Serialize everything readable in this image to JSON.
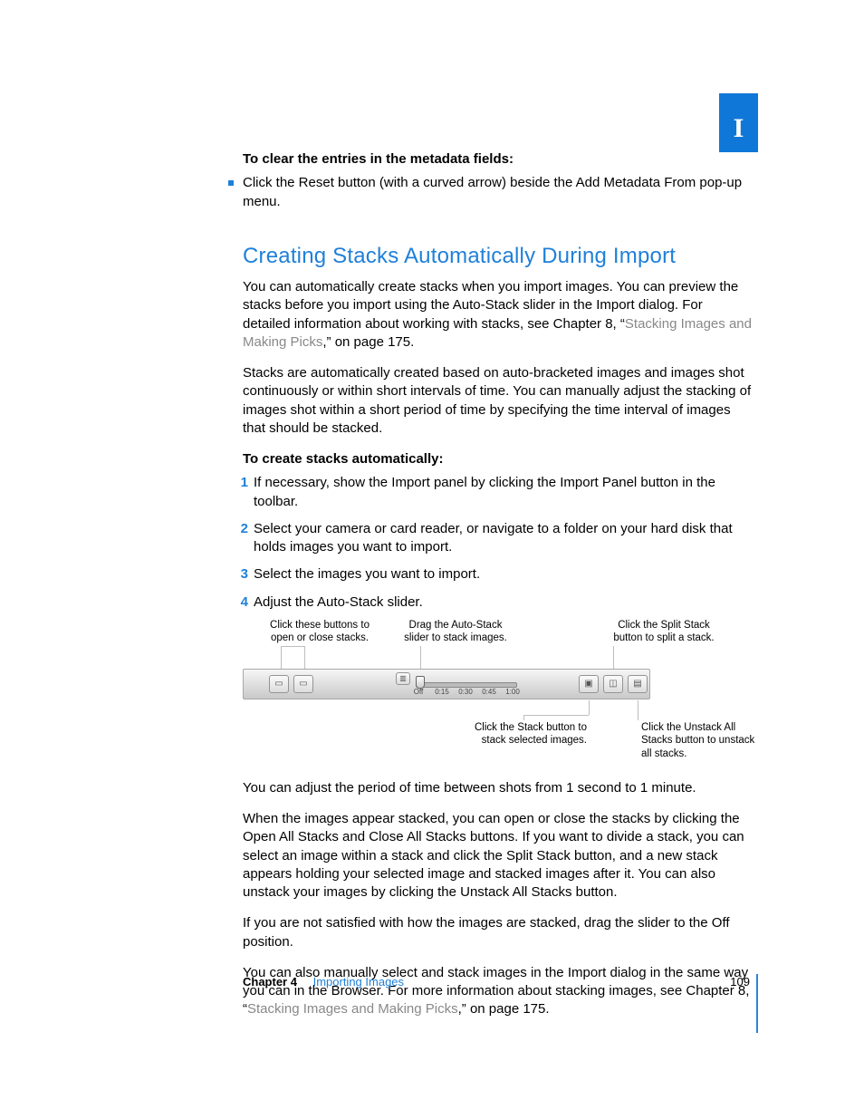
{
  "tab": "I",
  "intro": {
    "heading": "To clear the entries in the metadata fields:",
    "bullet": "Click the Reset button (with a curved arrow) beside the Add Metadata From pop-up menu."
  },
  "section": {
    "title": "Creating Stacks Automatically During Import",
    "p1a": "You can automatically create stacks when you import images. You can preview the stacks before you import using the Auto-Stack slider in the Import dialog. For detailed information about working with stacks, see Chapter 8, “",
    "p1_link": "Stacking Images and Making Picks",
    "p1b": ",” on page 175.",
    "p2": "Stacks are automatically created based on auto-bracketed images and images shot continuously or within short intervals of time. You can manually adjust the stacking of images shot within a short period of time by specifying the time interval of images that should be stacked.",
    "steps_heading": "To create stacks automatically:",
    "steps": [
      "If necessary, show the Import panel by clicking the Import Panel button in the toolbar.",
      "Select your camera or card reader, or navigate to a folder on your hard disk that holds images you want to import.",
      "Select the images you want to import.",
      "Adjust the Auto-Stack slider."
    ],
    "p3": "You can adjust the period of time between shots from 1 second to 1 minute.",
    "p4": "When the images appear stacked, you can open or close the stacks by clicking the Open All Stacks and Close All Stacks buttons. If you want to divide a stack, you can select an image within a stack and click the Split Stack button, and a new stack appears holding your selected image and stacked images after it. You can also unstack your images by clicking the Unstack All Stacks button.",
    "p5": "If you are not satisfied with how the images are stacked, drag the slider to the Off position.",
    "p6a": "You can also manually select and stack images in the Import dialog in the same way you can in the Browser. For more information about stacking images, see Chapter 8, “",
    "p6_link": "Stacking Images and Making Picks",
    "p6b": ",” on page 175."
  },
  "diagram": {
    "callouts": {
      "open_close": "Click these buttons to open or close stacks.",
      "drag_slider": "Drag the Auto-Stack slider to stack images.",
      "split": "Click the Split Stack button to split a stack.",
      "stack": "Click the Stack button to stack selected images.",
      "unstack": "Click the Unstack All Stacks button to unstack all stacks."
    },
    "ticks": [
      "Off",
      "0:15",
      "0:30",
      "0:45",
      "1:00"
    ]
  },
  "footer": {
    "chapter": "Chapter 4",
    "title": "Importing Images",
    "page": "109"
  }
}
